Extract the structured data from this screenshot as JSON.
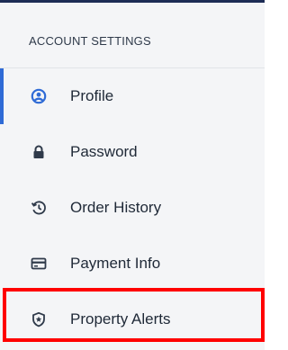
{
  "sidebar": {
    "section_title": "ACCOUNT SETTINGS",
    "items": [
      {
        "label": "Profile",
        "icon": "user-circle-icon",
        "active": true
      },
      {
        "label": "Password",
        "icon": "lock-icon",
        "active": false
      },
      {
        "label": "Order History",
        "icon": "history-icon",
        "active": false
      },
      {
        "label": "Payment Info",
        "icon": "credit-card-icon",
        "active": false
      },
      {
        "label": "Property Alerts",
        "icon": "shield-star-icon",
        "active": false
      }
    ]
  },
  "colors": {
    "accent": "#2f6bd6",
    "highlight": "#ff0000",
    "topbar": "#1d2c55",
    "panel_bg": "#f4f5f7"
  }
}
